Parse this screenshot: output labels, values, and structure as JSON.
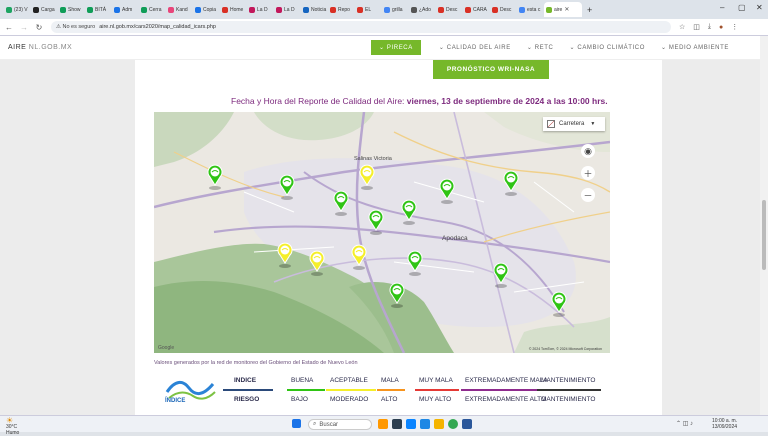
{
  "browser": {
    "tabs": [
      {
        "label": "(23) V",
        "color": "#1da462"
      },
      {
        "label": "Carga",
        "color": "#222222"
      },
      {
        "label": "Show",
        "color": "#0f9d58"
      },
      {
        "label": "BITÁ",
        "color": "#0f9d58"
      },
      {
        "label": "Adm",
        "color": "#1a73e8"
      },
      {
        "label": "Cerra",
        "color": "#0f9d58"
      },
      {
        "label": "Kand",
        "color": "#e8457a"
      },
      {
        "label": "Copia",
        "color": "#1a73e8"
      },
      {
        "label": "Home",
        "color": "#d93025"
      },
      {
        "label": "La D",
        "color": "#c2185b"
      },
      {
        "label": "La D",
        "color": "#c2185b"
      },
      {
        "label": "Noticia",
        "color": "#1565c0"
      },
      {
        "label": "Repo",
        "color": "#d93025"
      },
      {
        "label": "EL",
        "color": "#d93025"
      },
      {
        "label": "grilla",
        "color": "#4285f4"
      },
      {
        "label": "¿Ado",
        "color": "#555555"
      },
      {
        "label": "Desc",
        "color": "#d93025"
      },
      {
        "label": "CARA",
        "color": "#d93025"
      },
      {
        "label": "Desc",
        "color": "#d93025"
      },
      {
        "label": "esta c",
        "color": "#4285f4"
      },
      {
        "label": "aire",
        "color": "#76b82a",
        "active": true
      }
    ],
    "new_tab": "+",
    "security_label": "No es seguro",
    "url": "aire.nl.gob.mx/cars2020/map_calidad_icars.php"
  },
  "site": {
    "logo_bold": "AIRE",
    "logo_light": "NL.GOB.MX",
    "menu": [
      {
        "label": "PIRECA",
        "active": true
      },
      {
        "label": "CALIDAD DEL AIRE"
      },
      {
        "label": "RETC"
      },
      {
        "label": "CAMBIO CLIMÁTICO"
      },
      {
        "label": "MEDIO AMBIENTE"
      }
    ]
  },
  "content": {
    "forecast_button": "PRONÓSTICO WRI-NASA",
    "report_prefix": "Fecha y Hora del Reporte de Calidad del Aire:",
    "report_date": "viernes, 13 de septiembre de 2024 a las 10:00 hrs.",
    "footnote": "Valores generados por la red de monitoreo del Gobierno del Estado de Nuevo León"
  },
  "map": {
    "type_selector": "Carretera",
    "city_labels": [
      {
        "text": "Apodaca"
      },
      {
        "text": "Salinas Victoria"
      }
    ],
    "google": "Google",
    "attribution": "© 2024 TomTom, © 2024 Microsoft Corporation",
    "stations": [
      {
        "level": "buena",
        "color": "#2fc414"
      },
      {
        "level": "buena",
        "color": "#2fc414"
      },
      {
        "level": "aceptable",
        "color": "#f5ef2a"
      },
      {
        "level": "buena",
        "color": "#2fc414"
      },
      {
        "level": "buena",
        "color": "#2fc414"
      },
      {
        "level": "buena",
        "color": "#2fc414"
      },
      {
        "level": "buena",
        "color": "#2fc414"
      },
      {
        "level": "buena",
        "color": "#2fc414"
      },
      {
        "level": "aceptable",
        "color": "#f5ef2a"
      },
      {
        "level": "aceptable",
        "color": "#f5ef2a"
      },
      {
        "level": "aceptable",
        "color": "#f5ef2a"
      },
      {
        "level": "buena",
        "color": "#2fc414"
      },
      {
        "level": "buena",
        "color": "#2fc414"
      },
      {
        "level": "buena",
        "color": "#2fc414"
      },
      {
        "level": "buena",
        "color": "#2fc414"
      }
    ]
  },
  "legend": {
    "logo_text": "ÍNDICE",
    "row1_header": "INDICE",
    "row2_header": "RIESGO",
    "levels": [
      {
        "index": "BUENA",
        "risk": "BAJO",
        "color": "#2fc414"
      },
      {
        "index": "ACEPTABLE",
        "risk": "MODERADO",
        "color": "#f5ef2a"
      },
      {
        "index": "MALA",
        "risk": "ALTO",
        "color": "#f7941d"
      },
      {
        "index": "MUY MALA",
        "risk": "MUY ALTO",
        "color": "#e53935"
      },
      {
        "index": "EXTREMADAMENTE MALA",
        "risk": "EXTREMADAMENTE ALTO",
        "color": "#8e2b8e"
      },
      {
        "index": "MANTENIMIENTO",
        "risk": "MANTENIMIENTO",
        "color": "#333333"
      }
    ]
  },
  "taskbar": {
    "temperature": "30°C",
    "weather": "Humo",
    "search": "Buscar",
    "time": "10:00 a. m.",
    "date": "13/09/2024"
  }
}
